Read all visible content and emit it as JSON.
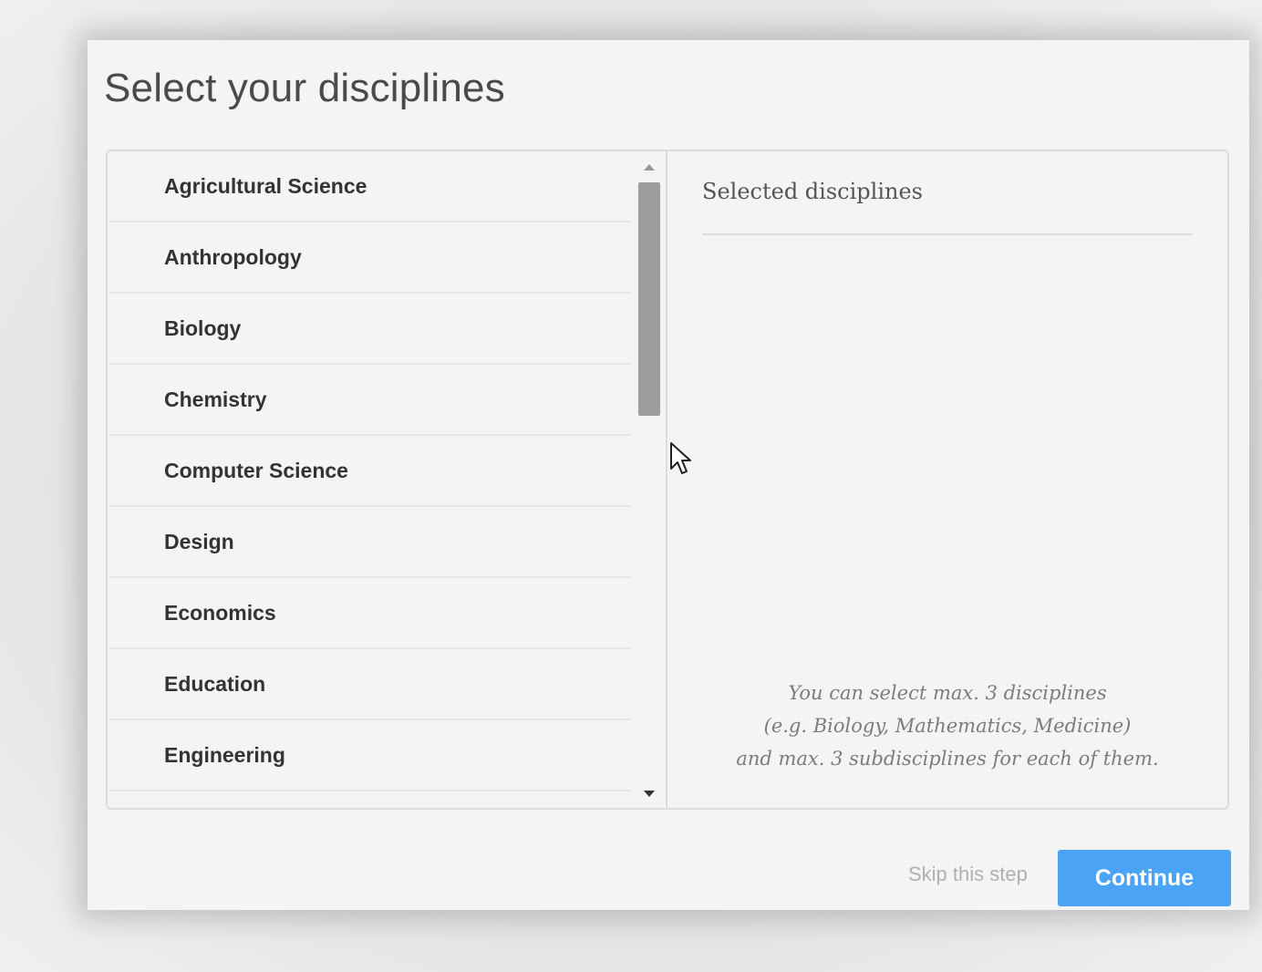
{
  "dialog": {
    "title": "Select your disciplines"
  },
  "disciplines": [
    "Agricultural Science",
    "Anthropology",
    "Biology",
    "Chemistry",
    "Computer Science",
    "Design",
    "Economics",
    "Education",
    "Engineering"
  ],
  "selected_panel": {
    "header": "Selected disciplines",
    "hint_line_1": "You can select max. 3 disciplines",
    "hint_line_2": "(e.g. Biology, Mathematics, Medicine)",
    "hint_line_3": "and max. 3 subdisciplines for each of them."
  },
  "actions": {
    "skip_label": "Skip this step",
    "continue_label": "Continue"
  },
  "colors": {
    "accent": "#4aa3f4",
    "dialog_bg": "#f4f4f6",
    "text_dark": "#333335"
  },
  "icons": {
    "scroll_up": "triangle-up-icon",
    "scroll_down": "triangle-down-icon",
    "cursor": "mouse-pointer-icon"
  }
}
